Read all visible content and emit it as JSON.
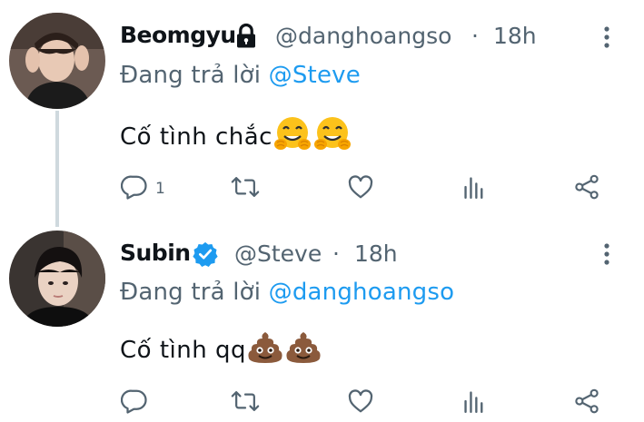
{
  "tweets": [
    {
      "name": "Beomgyu",
      "handle": "@danghoangso",
      "separator": "·",
      "time": "18h",
      "reply_prefix": "Đang trả lời",
      "reply_to": "@Steve",
      "text": "Cố tình chắc",
      "emojis": [
        "hugging-face-emoji",
        "hugging-face-emoji"
      ],
      "locked": true,
      "verified": false,
      "actions": {
        "reply_count": "1",
        "retweet_count": "",
        "like_count": ""
      }
    },
    {
      "name": "Subin",
      "handle": "@Steve",
      "separator": "·",
      "time": "18h",
      "reply_prefix": "Đang trả lời",
      "reply_to": "@danghoangso",
      "text": "Cố tình qq",
      "emojis": [
        "pile-of-poo-emoji",
        "pile-of-poo-emoji"
      ],
      "locked": false,
      "verified": true,
      "actions": {
        "reply_count": "",
        "retweet_count": "",
        "like_count": ""
      }
    }
  ],
  "colors": {
    "mention": "#1d9bf0",
    "secondary_text": "#536471",
    "icon": "#536471",
    "thread_line": "#cfd9de",
    "verified": "#1d9bf0"
  },
  "icons": [
    "lock-icon",
    "verified-badge-icon",
    "more-icon",
    "reply-icon",
    "retweet-icon",
    "like-icon",
    "analytics-icon",
    "share-icon"
  ]
}
